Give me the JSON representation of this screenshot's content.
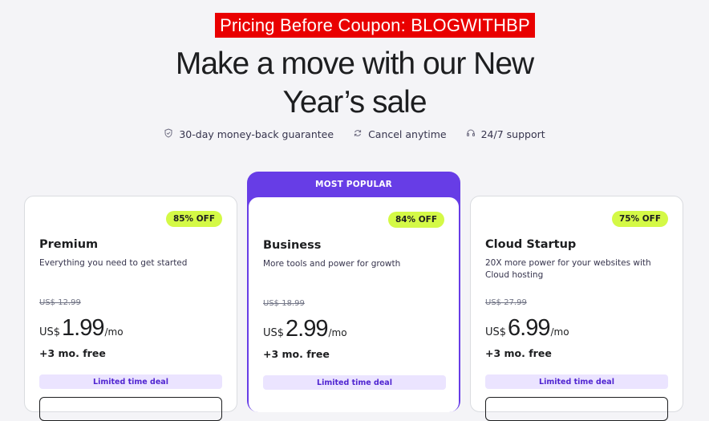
{
  "banner": {
    "text": "Pricing Before Coupon: BLOGWITHBP",
    "color": "#e90000"
  },
  "headline": {
    "line1": "Make a move with our New",
    "line2": "Year’s sale"
  },
  "features": [
    {
      "icon": "shield-check-icon",
      "label": "30-day money-back guarantee"
    },
    {
      "icon": "refresh-icon",
      "label": "Cancel anytime"
    },
    {
      "icon": "headset-icon",
      "label": "24/7 support"
    }
  ],
  "plans": [
    {
      "name": "Premium",
      "badge": "85% OFF",
      "description": "Everything you need to get started",
      "old_price": "US$ 12.99",
      "currency": "US$",
      "price": "1.99",
      "period": "/mo",
      "free": "+3 mo. free",
      "deal": "Limited time deal"
    },
    {
      "name": "Business",
      "badge": "84% OFF",
      "ribbon": "MOST POPULAR",
      "description": "More tools and power for growth",
      "old_price": "US$ 18.99",
      "currency": "US$",
      "price": "2.99",
      "period": "/mo",
      "free": "+3 mo. free",
      "deal": "Limited time deal"
    },
    {
      "name": "Cloud Startup",
      "badge": "75% OFF",
      "description": "20X more power for your websites with Cloud hosting",
      "old_price": "US$ 27.99",
      "currency": "US$",
      "price": "6.99",
      "period": "/mo",
      "free": "+3 mo. free",
      "deal": "Limited time deal"
    }
  ],
  "colors": {
    "accent": "#673de6",
    "badge": "#d4f946",
    "deal_bg": "#ebe4ff"
  }
}
